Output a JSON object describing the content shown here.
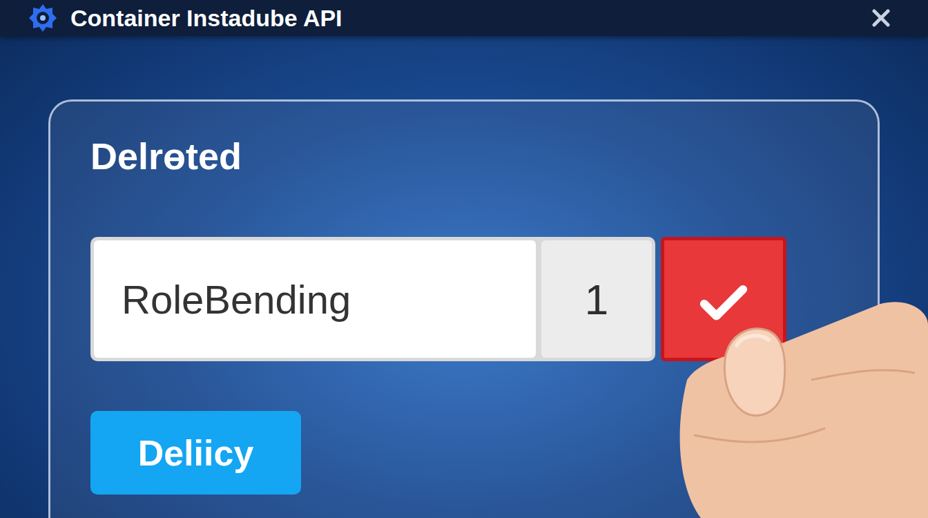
{
  "window": {
    "title": "Container Instadube API"
  },
  "dialog": {
    "title": "Delrɵted",
    "field": {
      "value": "RoleBending"
    },
    "count": "1",
    "button": "Deliicy"
  }
}
